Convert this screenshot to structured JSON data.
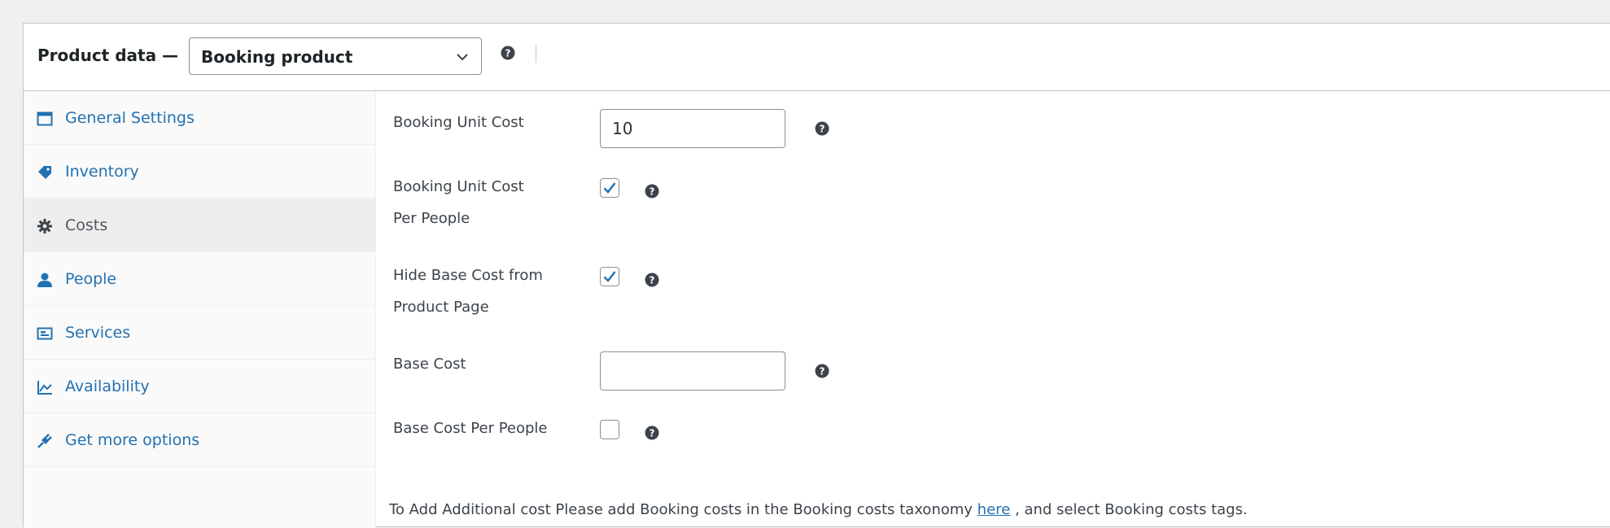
{
  "header": {
    "label": "Product data —",
    "product_type": "Booking product"
  },
  "tabs": [
    {
      "label": "General Settings",
      "icon": "calendar-icon",
      "active": false
    },
    {
      "label": "Inventory",
      "icon": "tag-icon",
      "active": false
    },
    {
      "label": "Costs",
      "icon": "gear-icon",
      "active": true
    },
    {
      "label": "People",
      "icon": "user-icon",
      "active": false
    },
    {
      "label": "Services",
      "icon": "services-icon",
      "active": false
    },
    {
      "label": "Availability",
      "icon": "chart-icon",
      "active": false
    },
    {
      "label": "Get more options",
      "icon": "plug-icon",
      "active": false
    }
  ],
  "fields": {
    "unit_cost": {
      "label": "Booking Unit Cost",
      "value": "10"
    },
    "unit_cost_per_people": {
      "label_line1": "Booking Unit Cost",
      "label_line2": "Per People",
      "checked": true
    },
    "hide_base_cost": {
      "label_line1": "Hide Base Cost from",
      "label_line2": "Product Page",
      "checked": true
    },
    "base_cost": {
      "label": "Base Cost",
      "value": ""
    },
    "base_cost_per_people": {
      "label": "Base Cost Per People",
      "checked": false
    }
  },
  "note": {
    "before": "To Add Additional cost Please add Booking costs in the Booking costs taxonomy ",
    "link": "here",
    "after": " , and select Booking costs tags."
  },
  "colors": {
    "link": "#2271b1",
    "active_tab_bg": "#eeeeee",
    "border": "#c3c4c7"
  }
}
